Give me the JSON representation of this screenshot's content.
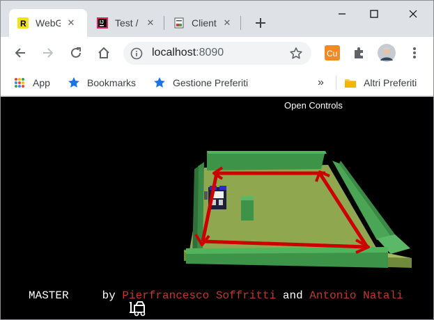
{
  "browser": {
    "tabs": [
      {
        "title": "WebGL",
        "favicon": "r-yellow-icon",
        "active": true
      },
      {
        "title": "Test / Test",
        "favicon": "intellij-icon",
        "active": false
      },
      {
        "title": "Client",
        "favicon": "document-icon",
        "active": false
      }
    ],
    "new_tab": "+",
    "address": {
      "host": "localhost",
      "port": ":8090"
    },
    "bookmarks": [
      {
        "label": "App",
        "icon": "apps-grid-icon"
      },
      {
        "label": "Bookmarks",
        "icon": "star-icon"
      },
      {
        "label": "Gestione Preferiti",
        "icon": "star-icon"
      }
    ],
    "bookmarks_overflow": "»",
    "other_bookmarks": "Altri Preferiti",
    "extension_badge": "Cu"
  },
  "page": {
    "open_controls": "Open Controls",
    "credits": {
      "prefix": "MASTER",
      "by": "by",
      "author1": "Pierfrancesco Soffritti",
      "and": "and",
      "author2": "Antonio Natali"
    }
  },
  "colors": {
    "floor": "#8fa84f",
    "wall": "#3f9a4a",
    "path": "#cc0000",
    "author": "#c0392b",
    "background": "#000000"
  }
}
